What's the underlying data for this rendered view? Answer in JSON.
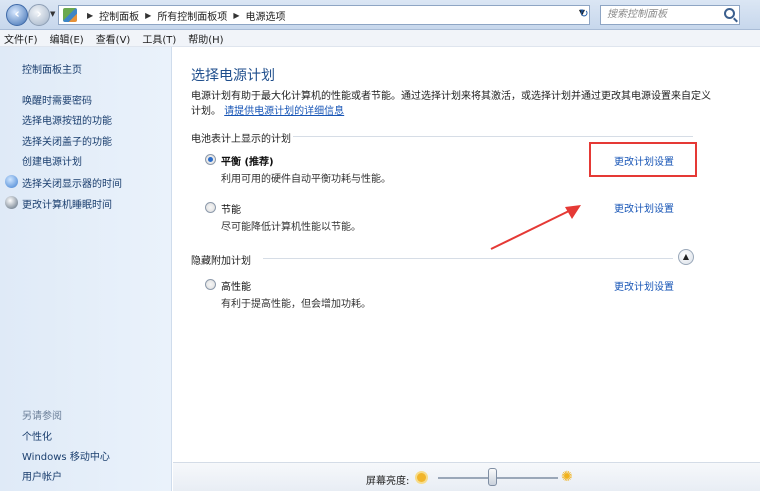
{
  "address": {
    "breadcrumbs": [
      "控制面板",
      "所有控制面板项",
      "电源选项"
    ],
    "search_placeholder": "搜索控制面板"
  },
  "menu": [
    "文件(F)",
    "编辑(E)",
    "查看(V)",
    "工具(T)",
    "帮助(H)"
  ],
  "sidebar": {
    "home": "控制面板主页",
    "links": [
      "唤醒时需要密码",
      "选择电源按钮的功能",
      "选择关闭盖子的功能",
      "创建电源计划",
      "选择关闭显示器的时间",
      "更改计算机睡眠时间"
    ],
    "see_also_label": "另请参阅",
    "see_also": [
      "个性化",
      "Windows 移动中心",
      "用户帐户"
    ]
  },
  "main": {
    "title": "选择电源计划",
    "description": "电源计划有助于最大化计算机的性能或者节能。通过选择计划来将其激活，或选择计划并通过更改其电源设置来自定义计划。",
    "description_link": "请提供电源计划的详细信息",
    "battery_meter_heading": "电池表计上显示的计划",
    "hidden_heading": "隐藏附加计划",
    "plans": [
      {
        "name": "平衡 (推荐)",
        "desc": "利用可用的硬件自动平衡功耗与性能。",
        "link": "更改计划设置",
        "selected": true
      },
      {
        "name": "节能",
        "desc": "尽可能降低计算机性能以节能。",
        "link": "更改计划设置",
        "selected": false
      },
      {
        "name": "高性能",
        "desc": "有利于提高性能，但会增加功耗。",
        "link": "更改计划设置",
        "selected": false
      }
    ]
  },
  "bottom": {
    "brightness_label": "屏幕亮度:",
    "brightness_level": 0.45
  },
  "colors": {
    "link": "#1755b6",
    "title": "#1f4e8c",
    "highlight": "#e53935"
  }
}
